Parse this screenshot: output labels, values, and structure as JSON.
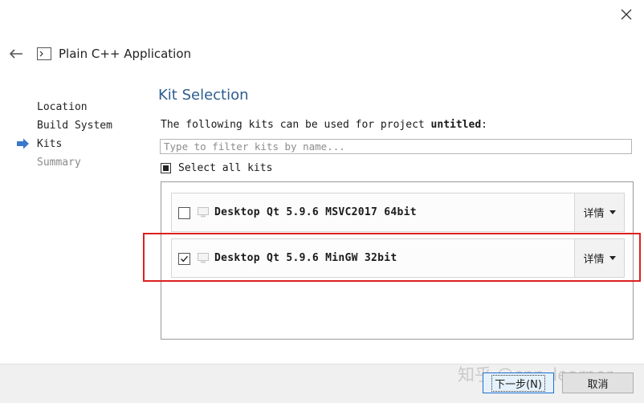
{
  "window": {
    "title": "Plain C++ Application"
  },
  "steps": [
    {
      "label": "Location",
      "state": "done"
    },
    {
      "label": "Build System",
      "state": "done"
    },
    {
      "label": "Kits",
      "state": "current"
    },
    {
      "label": "Summary",
      "state": "pending"
    }
  ],
  "page": {
    "heading": "Kit Selection",
    "intro_text": "The following kits can be used for project ",
    "project_name": "untitled",
    "intro_suffix": ":",
    "filter_placeholder": "Type to filter kits by name...",
    "filter_value": "",
    "select_all_label": "Select all kits",
    "select_all_state": "partial"
  },
  "kits": [
    {
      "name": "Desktop Qt 5.9.6 MSVC2017 64bit",
      "checked": false,
      "details_label": "详情"
    },
    {
      "name": "Desktop Qt 5.9.6 MinGW 32bit",
      "checked": true,
      "details_label": "详情"
    }
  ],
  "buttons": {
    "next": "下一步(N)",
    "cancel": "取消"
  },
  "watermark": "知乎 @cpp_learner",
  "colors": {
    "heading": "#2c5d8e",
    "highlight": "#dd2020",
    "step_arrow": "#3a78c9"
  }
}
